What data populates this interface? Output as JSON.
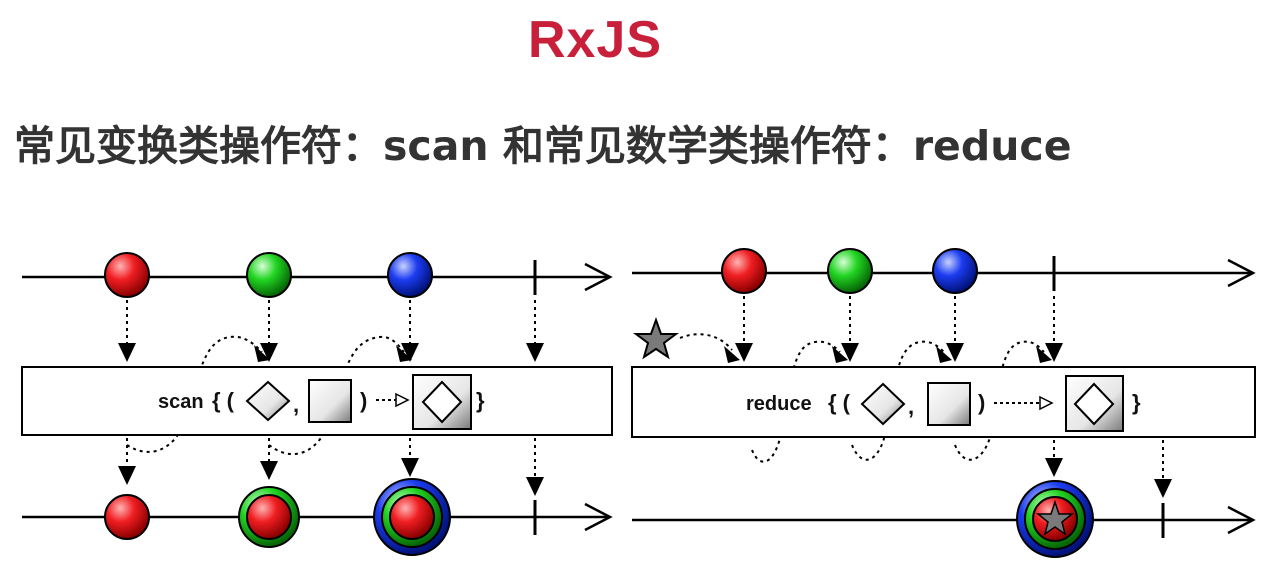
{
  "header": {
    "title": "RxJS",
    "subtitle": "常见变换类操作符：scan 和常见数学类操作符：reduce"
  },
  "diagrams": {
    "scan": {
      "operator_label": "scan",
      "open_brace": "{ (",
      "comma": ",",
      "paren_close": ")",
      "close_brace": "}"
    },
    "reduce": {
      "operator_label": "reduce",
      "open_brace": "{ (",
      "comma": ",",
      "paren_close": ")",
      "close_brace": "}"
    }
  },
  "colors": {
    "title": "#c8203a",
    "subtitle": "#333333",
    "marble_red": "#e8141b",
    "marble_green": "#1fcc1f",
    "marble_blue": "#1a3cf0",
    "star": "#7a7a7a"
  }
}
